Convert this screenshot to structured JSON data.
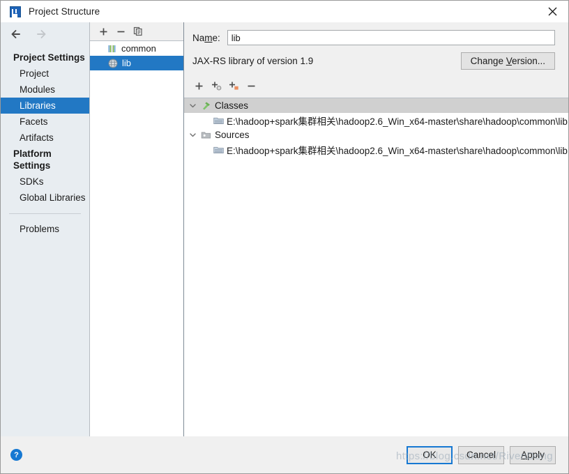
{
  "window": {
    "title": "Project Structure",
    "app_icon": "intellij-idea-icon",
    "close_icon": "close-icon"
  },
  "sidebar": {
    "back_icon": "arrow-left-icon",
    "forward_icon": "arrow-right-icon",
    "groups": [
      {
        "label": "Project Settings",
        "items": [
          {
            "label": "Project",
            "selected": false
          },
          {
            "label": "Modules",
            "selected": false
          },
          {
            "label": "Libraries",
            "selected": true
          },
          {
            "label": "Facets",
            "selected": false
          },
          {
            "label": "Artifacts",
            "selected": false
          }
        ]
      },
      {
        "label": "Platform Settings",
        "items": [
          {
            "label": "SDKs",
            "selected": false
          },
          {
            "label": "Global Libraries",
            "selected": false
          }
        ]
      }
    ],
    "problems_label": "Problems"
  },
  "library_panel": {
    "toolbar": [
      {
        "name": "add-library-button",
        "glyph": "+"
      },
      {
        "name": "remove-library-button",
        "glyph": "−"
      },
      {
        "name": "copy-library-button",
        "glyph": "copy-icon"
      }
    ],
    "items": [
      {
        "label": "common",
        "icon": "module-icon",
        "selected": false
      },
      {
        "label": "lib",
        "icon": "globe-icon",
        "selected": true
      }
    ]
  },
  "detail": {
    "name_label": "Name:",
    "name_label_pre": "Na",
    "name_label_accel": "m",
    "name_label_post": "e:",
    "name_value": "lib",
    "name_placeholder": "",
    "version_text": "JAX-RS library of version 1.9",
    "change_version_pre": "Change ",
    "change_version_accel": "V",
    "change_version_post": "ersion...",
    "toolbar": [
      {
        "name": "add-root-button",
        "glyph": "add-icon"
      },
      {
        "name": "attach-classes-button",
        "glyph": "add-classes-icon"
      },
      {
        "name": "attach-sources-button",
        "glyph": "add-sources-icon"
      },
      {
        "name": "remove-root-button",
        "glyph": "remove-icon"
      }
    ],
    "tree": [
      {
        "label": "Classes",
        "icon": "classes-hammer-icon",
        "expanded": true,
        "selected": true,
        "children": [
          {
            "label": "E:\\hadoop+spark集群相关\\hadoop2.6_Win_x64-master\\share\\hadoop\\common\\lib",
            "icon": "jar-folder-icon"
          }
        ]
      },
      {
        "label": "Sources",
        "icon": "sources-folder-icon",
        "expanded": true,
        "selected": false,
        "children": [
          {
            "label": "E:\\hadoop+spark集群相关\\hadoop2.6_Win_x64-master\\share\\hadoop\\common\\lib",
            "icon": "jar-folder-icon"
          }
        ]
      }
    ]
  },
  "footer": {
    "help_icon": "help-icon",
    "help_glyph": "?",
    "ok_label": "OK",
    "cancel_label": "Cancel",
    "apply_pre": "",
    "apply_accel": "A",
    "apply_post": "pply",
    "watermark": "https://blog.csdn.net/RivenDong"
  },
  "colors": {
    "selection_blue": "#2278c4",
    "focus_blue": "#1678d2",
    "sidebar_bg": "#e8edf1",
    "dialog_bg": "#f0f0f0",
    "tree_selected_gray": "#d0d0d0"
  }
}
